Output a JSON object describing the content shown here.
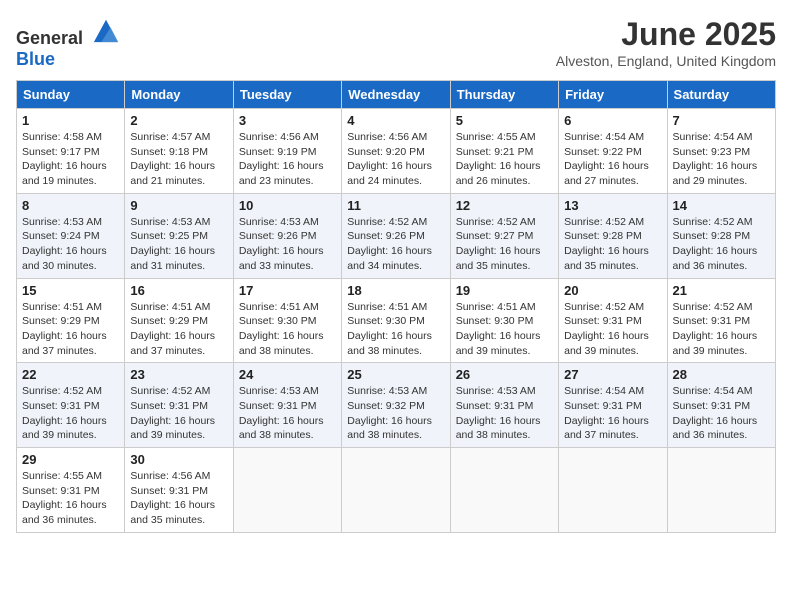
{
  "logo": {
    "text_general": "General",
    "text_blue": "Blue"
  },
  "title": "June 2025",
  "location": "Alveston, England, United Kingdom",
  "days_of_week": [
    "Sunday",
    "Monday",
    "Tuesday",
    "Wednesday",
    "Thursday",
    "Friday",
    "Saturday"
  ],
  "weeks": [
    [
      {
        "day": "1",
        "sunrise": "4:58 AM",
        "sunset": "9:17 PM",
        "daylight": "16 hours and 19 minutes."
      },
      {
        "day": "2",
        "sunrise": "4:57 AM",
        "sunset": "9:18 PM",
        "daylight": "16 hours and 21 minutes."
      },
      {
        "day": "3",
        "sunrise": "4:56 AM",
        "sunset": "9:19 PM",
        "daylight": "16 hours and 23 minutes."
      },
      {
        "day": "4",
        "sunrise": "4:56 AM",
        "sunset": "9:20 PM",
        "daylight": "16 hours and 24 minutes."
      },
      {
        "day": "5",
        "sunrise": "4:55 AM",
        "sunset": "9:21 PM",
        "daylight": "16 hours and 26 minutes."
      },
      {
        "day": "6",
        "sunrise": "4:54 AM",
        "sunset": "9:22 PM",
        "daylight": "16 hours and 27 minutes."
      },
      {
        "day": "7",
        "sunrise": "4:54 AM",
        "sunset": "9:23 PM",
        "daylight": "16 hours and 29 minutes."
      }
    ],
    [
      {
        "day": "8",
        "sunrise": "4:53 AM",
        "sunset": "9:24 PM",
        "daylight": "16 hours and 30 minutes."
      },
      {
        "day": "9",
        "sunrise": "4:53 AM",
        "sunset": "9:25 PM",
        "daylight": "16 hours and 31 minutes."
      },
      {
        "day": "10",
        "sunrise": "4:53 AM",
        "sunset": "9:26 PM",
        "daylight": "16 hours and 33 minutes."
      },
      {
        "day": "11",
        "sunrise": "4:52 AM",
        "sunset": "9:26 PM",
        "daylight": "16 hours and 34 minutes."
      },
      {
        "day": "12",
        "sunrise": "4:52 AM",
        "sunset": "9:27 PM",
        "daylight": "16 hours and 35 minutes."
      },
      {
        "day": "13",
        "sunrise": "4:52 AM",
        "sunset": "9:28 PM",
        "daylight": "16 hours and 35 minutes."
      },
      {
        "day": "14",
        "sunrise": "4:52 AM",
        "sunset": "9:28 PM",
        "daylight": "16 hours and 36 minutes."
      }
    ],
    [
      {
        "day": "15",
        "sunrise": "4:51 AM",
        "sunset": "9:29 PM",
        "daylight": "16 hours and 37 minutes."
      },
      {
        "day": "16",
        "sunrise": "4:51 AM",
        "sunset": "9:29 PM",
        "daylight": "16 hours and 37 minutes."
      },
      {
        "day": "17",
        "sunrise": "4:51 AM",
        "sunset": "9:30 PM",
        "daylight": "16 hours and 38 minutes."
      },
      {
        "day": "18",
        "sunrise": "4:51 AM",
        "sunset": "9:30 PM",
        "daylight": "16 hours and 38 minutes."
      },
      {
        "day": "19",
        "sunrise": "4:51 AM",
        "sunset": "9:30 PM",
        "daylight": "16 hours and 39 minutes."
      },
      {
        "day": "20",
        "sunrise": "4:52 AM",
        "sunset": "9:31 PM",
        "daylight": "16 hours and 39 minutes."
      },
      {
        "day": "21",
        "sunrise": "4:52 AM",
        "sunset": "9:31 PM",
        "daylight": "16 hours and 39 minutes."
      }
    ],
    [
      {
        "day": "22",
        "sunrise": "4:52 AM",
        "sunset": "9:31 PM",
        "daylight": "16 hours and 39 minutes."
      },
      {
        "day": "23",
        "sunrise": "4:52 AM",
        "sunset": "9:31 PM",
        "daylight": "16 hours and 39 minutes."
      },
      {
        "day": "24",
        "sunrise": "4:53 AM",
        "sunset": "9:31 PM",
        "daylight": "16 hours and 38 minutes."
      },
      {
        "day": "25",
        "sunrise": "4:53 AM",
        "sunset": "9:32 PM",
        "daylight": "16 hours and 38 minutes."
      },
      {
        "day": "26",
        "sunrise": "4:53 AM",
        "sunset": "9:31 PM",
        "daylight": "16 hours and 38 minutes."
      },
      {
        "day": "27",
        "sunrise": "4:54 AM",
        "sunset": "9:31 PM",
        "daylight": "16 hours and 37 minutes."
      },
      {
        "day": "28",
        "sunrise": "4:54 AM",
        "sunset": "9:31 PM",
        "daylight": "16 hours and 36 minutes."
      }
    ],
    [
      {
        "day": "29",
        "sunrise": "4:55 AM",
        "sunset": "9:31 PM",
        "daylight": "16 hours and 36 minutes."
      },
      {
        "day": "30",
        "sunrise": "4:56 AM",
        "sunset": "9:31 PM",
        "daylight": "16 hours and 35 minutes."
      },
      null,
      null,
      null,
      null,
      null
    ]
  ],
  "labels": {
    "sunrise": "Sunrise:",
    "sunset": "Sunset:",
    "daylight": "Daylight:"
  }
}
